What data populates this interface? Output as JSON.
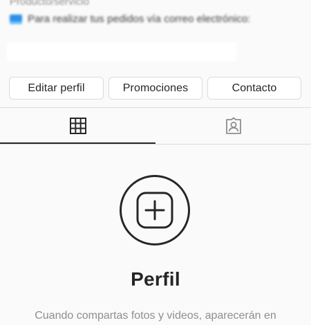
{
  "profile": {
    "category": "Producto/servicio",
    "bio_line": "Para realizar tus pedidos vía correo electrónico:",
    "bio_emoji_icon": "blue-emoji-icon"
  },
  "actions": {
    "edit_label": "Editar perfil",
    "promotions_label": "Promociones",
    "contact_label": "Contacto"
  },
  "tabs": [
    {
      "icon": "grid-icon",
      "active": true
    },
    {
      "icon": "tagged-person-icon",
      "active": false
    }
  ],
  "empty_state": {
    "icon": "add-post-icon",
    "title": "Perfil",
    "description": "Cuando compartas fotos y videos, aparecerán en"
  },
  "colors": {
    "text": "#262626",
    "secondary_text": "#8e8e8e",
    "border": "#dbdbdb",
    "background": "#fafafa"
  }
}
